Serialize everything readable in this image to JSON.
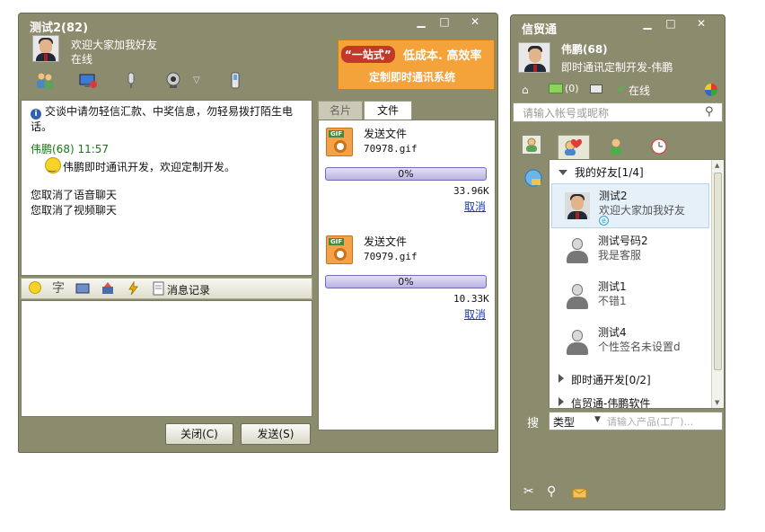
{
  "chat_window": {
    "title": "测试2(82)",
    "peer_signature": "欢迎大家加我好友",
    "peer_status": "在线",
    "ad_tag": "“一站式”",
    "ad_line1": "低成本. 高效率",
    "ad_line2": "定制即时通讯系统",
    "toolbar_icons": [
      "users-icon",
      "share-screen-icon",
      "microphone-icon",
      "webcam-icon",
      "phone-icon"
    ],
    "system_notice": "交谈中请勿轻信汇款、中奖信息，勿轻易拨打陌生电话。",
    "sender_line": "伟鹏(68) 11:57",
    "message_text": "伟鹏即时通讯开发，欢迎定制开发。",
    "cancel_voice": "您取消了语音聊天",
    "cancel_video": "您取消了视频聊天",
    "font_button": "字",
    "history_label": "消息记录",
    "close_button": "关闭(C)",
    "send_button": "发送(S)",
    "tab_card": "名片",
    "tab_file": "文件",
    "transfers": [
      {
        "title": "发送文件",
        "filename": "70978.gif",
        "progress": "0%",
        "size": "33.96K",
        "cancel": "取消"
      },
      {
        "title": "发送文件",
        "filename": "70979.gif",
        "progress": "0%",
        "size": "10.33K",
        "cancel": "取消"
      }
    ]
  },
  "buddy_window": {
    "title": "信贸通",
    "user_name": "伟鹏(68)",
    "user_signature": "即时通讯定制开发-伟鹏",
    "mail_count": "(0)",
    "status": "在线",
    "search_placeholder": "请输入帐号或昵称",
    "groups": [
      {
        "label": "我的好友[1/4]",
        "expanded": true
      },
      {
        "label": "即时通开发[0/2]",
        "expanded": false
      },
      {
        "label": "信贸通-伟鹏软件",
        "expanded": false
      }
    ],
    "contacts": [
      {
        "name": "测试2",
        "signature": "欢迎大家加我好友",
        "online": true
      },
      {
        "name": "测试号码2",
        "signature": "我是客服",
        "online": false
      },
      {
        "name": "测试1",
        "signature": "不错1",
        "online": false
      },
      {
        "name": "测试4",
        "signature": "个性签名未设置d",
        "online": false
      }
    ],
    "search_label": "搜",
    "type_select": "类型",
    "product_placeholder": "请输入产品(工厂)..."
  },
  "colors": {
    "frame": "#8b8b6e",
    "accent_green": "#167816",
    "link_blue": "#1a3aa5",
    "ad_orange": "#f4a23a"
  }
}
